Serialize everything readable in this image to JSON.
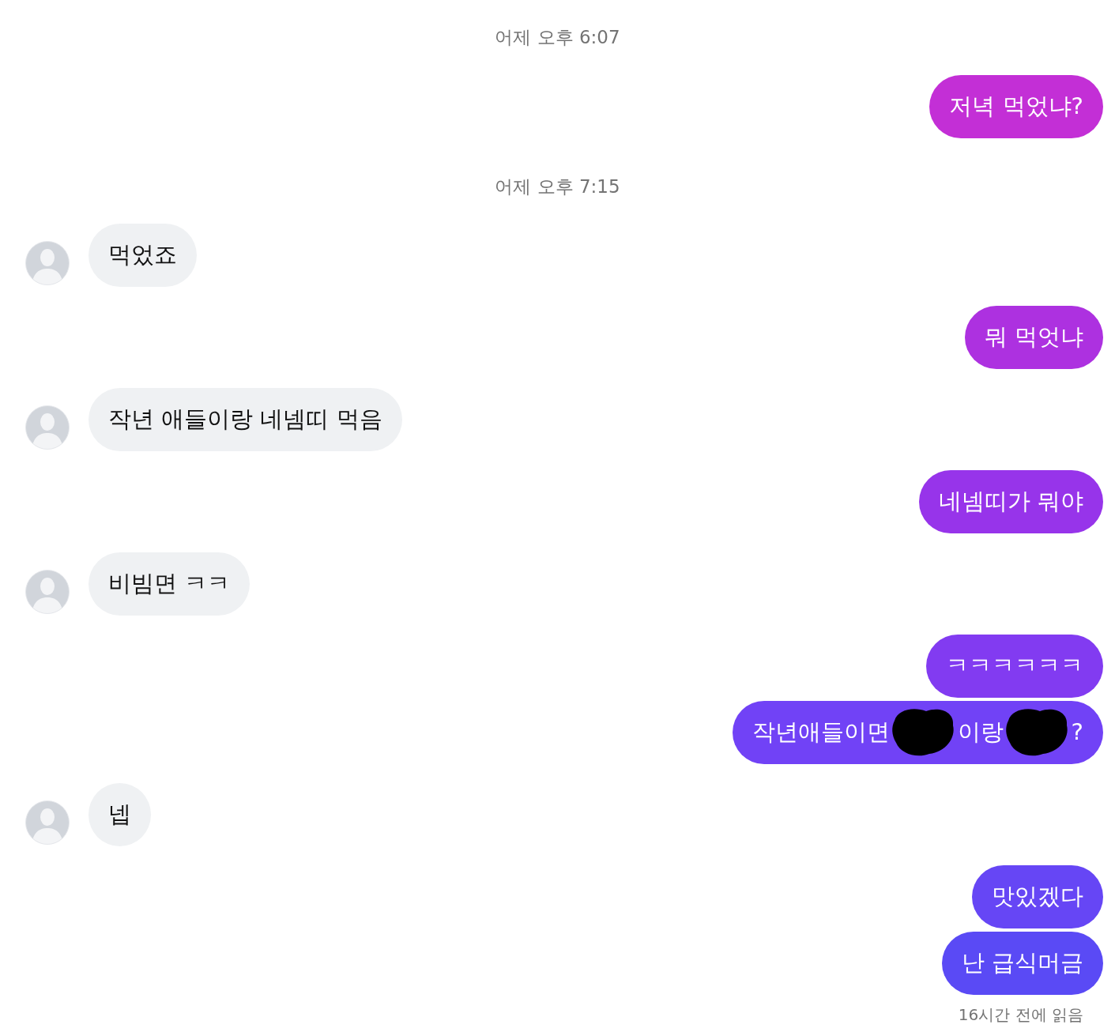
{
  "messages": [
    {
      "kind": "timestamp",
      "text": "어제 오후 6:07"
    },
    {
      "kind": "outgoing",
      "parts": [
        {
          "kind": "text",
          "text": "저녁 먹었냐?"
        }
      ]
    },
    {
      "kind": "timestamp",
      "text": "어제 오후 7:15"
    },
    {
      "kind": "incoming",
      "parts": [
        {
          "kind": "text",
          "text": "먹었죠"
        }
      ]
    },
    {
      "kind": "outgoing",
      "parts": [
        {
          "kind": "text",
          "text": "뭐 먹엇냐"
        }
      ]
    },
    {
      "kind": "incoming",
      "parts": [
        {
          "kind": "text",
          "text": "작년 애들이랑 네넴띠 먹음"
        }
      ]
    },
    {
      "kind": "outgoing",
      "parts": [
        {
          "kind": "text",
          "text": "네넴띠가 뭐야"
        }
      ]
    },
    {
      "kind": "incoming",
      "parts": [
        {
          "kind": "text",
          "text": "비빔면 ㅋㅋ"
        }
      ]
    },
    {
      "kind": "outgoing",
      "parts": [
        {
          "kind": "text",
          "text": "ㅋㅋㅋㅋㅋㅋ"
        }
      ]
    },
    {
      "kind": "outgoing",
      "parts": [
        {
          "kind": "text",
          "text": "작년애들이면"
        },
        {
          "kind": "redacted"
        },
        {
          "kind": "text",
          "text": "이랑"
        },
        {
          "kind": "redacted"
        },
        {
          "kind": "text",
          "text": "?"
        }
      ]
    },
    {
      "kind": "incoming",
      "parts": [
        {
          "kind": "text",
          "text": "넵"
        }
      ]
    },
    {
      "kind": "outgoing",
      "parts": [
        {
          "kind": "text",
          "text": "맛있겠다"
        }
      ]
    },
    {
      "kind": "outgoing",
      "parts": [
        {
          "kind": "text",
          "text": "난 급식머금"
        }
      ]
    }
  ],
  "read_receipt": "16시간 전에 읽음"
}
